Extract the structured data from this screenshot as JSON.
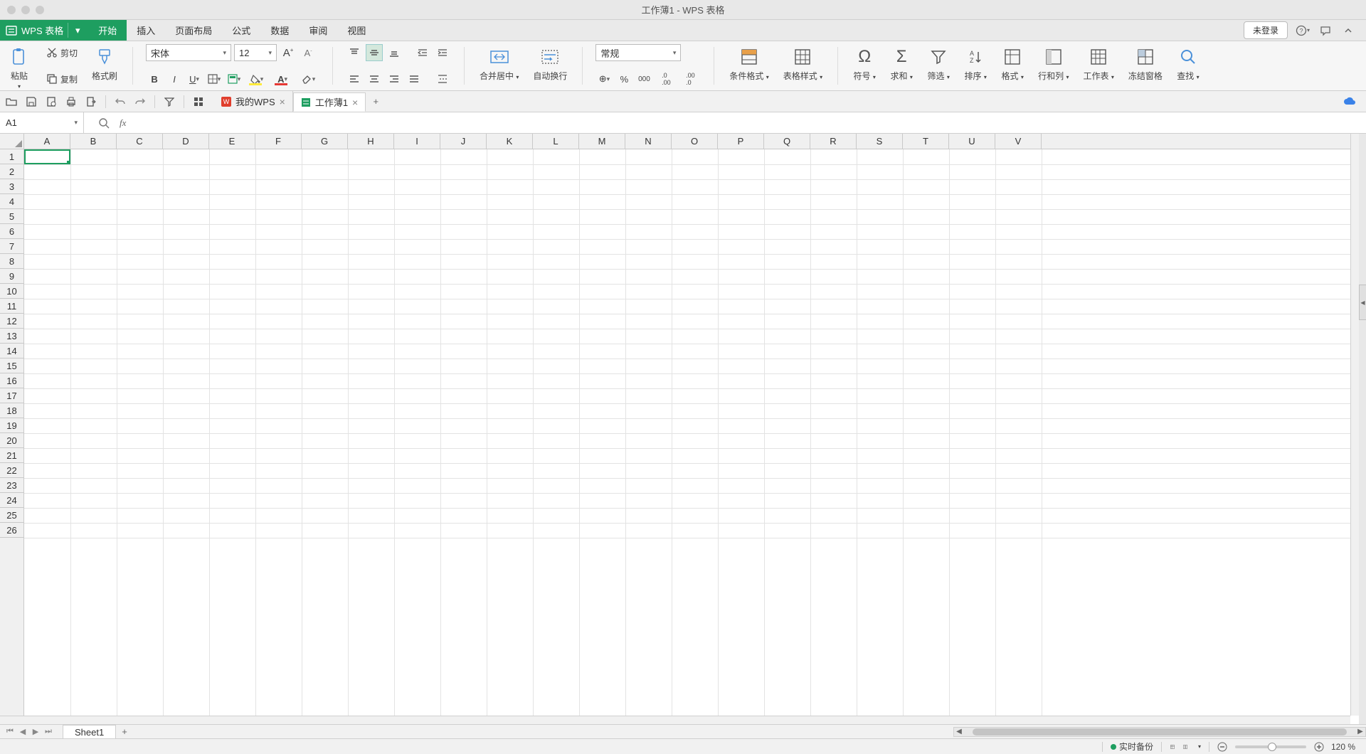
{
  "window": {
    "title": "工作薄1 - WPS 表格"
  },
  "app_badge": {
    "name": "WPS 表格"
  },
  "menu": {
    "items": [
      "开始",
      "插入",
      "页面布局",
      "公式",
      "数据",
      "审阅",
      "视图"
    ],
    "active_index": 0
  },
  "topright": {
    "login": "未登录"
  },
  "ribbon": {
    "paste": "粘贴",
    "cut": "剪切",
    "copy": "复制",
    "format_painter": "格式刷",
    "font_name": "宋体",
    "font_size": "12",
    "merge_center": "合并居中",
    "wrap_text": "自动换行",
    "number_format": "常规",
    "cond_fmt": "条件格式",
    "table_style": "表格样式",
    "symbol": "符号",
    "sum": "求和",
    "filter": "筛选",
    "sort": "排序",
    "format": "格式",
    "rowcol": "行和列",
    "worksheet": "工作表",
    "freeze": "冻结窗格",
    "find": "查找"
  },
  "doctabs": {
    "tab1": "我的WPS",
    "tab2": "工作薄1"
  },
  "namebox": {
    "value": "A1"
  },
  "formula": {
    "value": ""
  },
  "grid": {
    "columns": [
      "A",
      "B",
      "C",
      "D",
      "E",
      "F",
      "G",
      "H",
      "I",
      "J",
      "K",
      "L",
      "M",
      "N",
      "O",
      "P",
      "Q",
      "R",
      "S",
      "T",
      "U",
      "V"
    ],
    "row_count": 26,
    "active_cell": "A1"
  },
  "sheettabs": {
    "active": "Sheet1"
  },
  "statusbar": {
    "backup": "实时备份",
    "zoom": "120 %"
  }
}
